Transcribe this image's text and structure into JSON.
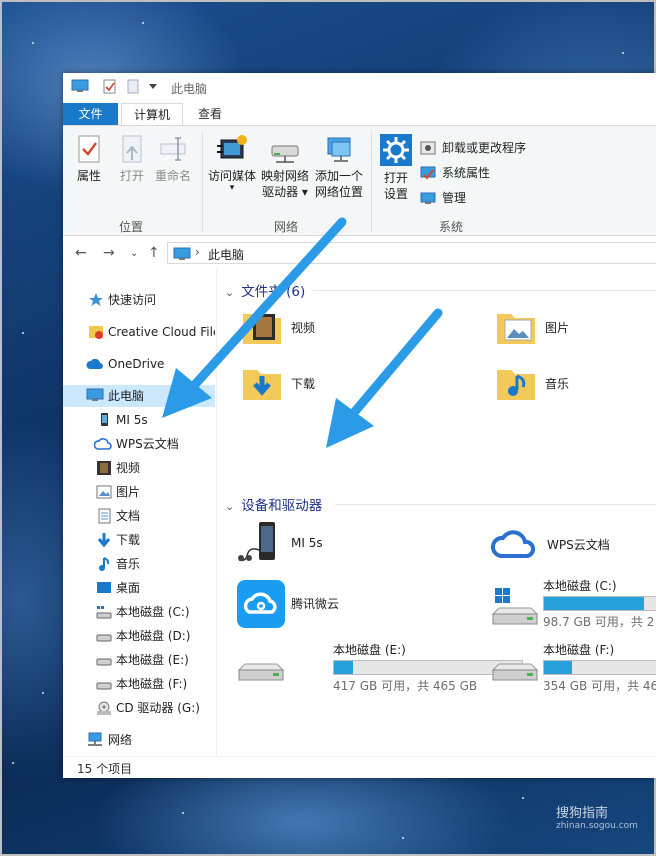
{
  "window": {
    "title": "此电脑"
  },
  "tabs": {
    "file": "文件",
    "computer": "计算机",
    "view": "查看"
  },
  "ribbon": {
    "location": {
      "label": "位置",
      "properties": "属性",
      "open": "打开",
      "rename": "重命名"
    },
    "network": {
      "label": "网络",
      "access_media": "访问媒体",
      "map_drive_1": "映射网络",
      "map_drive_2": "驱动器",
      "add_location_1": "添加一个",
      "add_location_2": "网络位置"
    },
    "system": {
      "label": "系统",
      "open_settings_1": "打开",
      "open_settings_2": "设置",
      "uninstall": "卸载或更改程序",
      "system_properties": "系统属性",
      "manage": "管理"
    }
  },
  "address": {
    "path": "此电脑",
    "separator": "›"
  },
  "sidebar": {
    "items": [
      {
        "label": "快速访问",
        "icon": "star-icon"
      },
      {
        "label": "Creative Cloud File",
        "icon": "creative-cloud-icon"
      },
      {
        "label": "OneDrive",
        "icon": "cloud-icon"
      },
      {
        "label": "此电脑",
        "icon": "computer-icon",
        "selected": true
      },
      {
        "label": "MI 5s",
        "icon": "phone-icon"
      },
      {
        "label": "WPS云文档",
        "icon": "wps-cloud-icon"
      },
      {
        "label": "视频",
        "icon": "video-icon"
      },
      {
        "label": "图片",
        "icon": "picture-icon"
      },
      {
        "label": "文档",
        "icon": "document-icon"
      },
      {
        "label": "下载",
        "icon": "download-icon"
      },
      {
        "label": "音乐",
        "icon": "music-icon"
      },
      {
        "label": "桌面",
        "icon": "desktop-icon"
      },
      {
        "label": "本地磁盘 (C:)",
        "icon": "drive-c-icon"
      },
      {
        "label": "本地磁盘 (D:)",
        "icon": "drive-icon"
      },
      {
        "label": "本地磁盘 (E:)",
        "icon": "drive-icon"
      },
      {
        "label": "本地磁盘 (F:)",
        "icon": "drive-icon"
      },
      {
        "label": "CD 驱动器 (G:)",
        "icon": "cd-drive-icon"
      },
      {
        "label": "网络",
        "icon": "network-icon"
      }
    ]
  },
  "content": {
    "folders_header": "文件夹 (6)",
    "folders": [
      {
        "label": "视频",
        "icon": "video-folder-icon"
      },
      {
        "label": "图片",
        "icon": "picture-folder-icon"
      },
      {
        "label": "下载",
        "icon": "download-folder-icon"
      },
      {
        "label": "音乐",
        "icon": "music-folder-icon"
      }
    ],
    "devices_header": "设备和驱动器",
    "devices": [
      {
        "label": "MI 5s",
        "icon": "phone-device-icon"
      },
      {
        "label": "WPS云文档",
        "icon": "wps-cloud-device-icon"
      },
      {
        "label": "腾讯微云",
        "icon": "weiyun-icon"
      }
    ],
    "drives": [
      {
        "label": "本地磁盘 (C:)",
        "free": "98.7 GB 可用，共 2",
        "used_fraction": 0.85
      },
      {
        "label": "本地磁盘 (E:)",
        "free": "417 GB 可用，共 465 GB",
        "used_fraction": 0.1
      },
      {
        "label": "本地磁盘 (F:)",
        "free": "354 GB 可用，共 46",
        "used_fraction": 0.24
      }
    ]
  },
  "status": {
    "count": "15 个项目"
  },
  "watermark": {
    "brand": "搜狗指南",
    "url": "zhinan.sogou.com"
  },
  "colors": {
    "accent": "#1979ca",
    "arrow": "#2b9be8",
    "drive_fill": "#26a0da"
  }
}
